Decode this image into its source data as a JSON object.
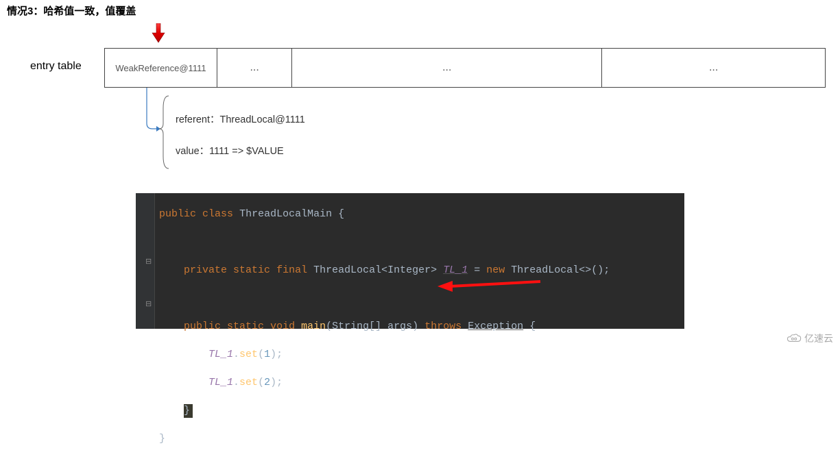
{
  "title": "情况3：哈希值一致，值覆盖",
  "table_label": "entry table",
  "cells": {
    "c0": "WeakReference@1111",
    "c1": "...",
    "c2": "...",
    "c3": "..."
  },
  "detail": {
    "referent": "referent：ThreadLocal@1111",
    "value": "value：1111  => $VALUE"
  },
  "code": {
    "l1_public": "public",
    "l1_class": "class",
    "l1_name": "ThreadLocalMain",
    "l1_brace": " {",
    "l3_private": "private",
    "l3_static": "static",
    "l3_final": "final",
    "l3_type": "ThreadLocal",
    "l3_generic_open": "<",
    "l3_gtype": "Integer",
    "l3_generic_close": ">",
    "l3_field": "TL_1",
    "l3_eq": " = ",
    "l3_new": "new",
    "l3_ctor": " ThreadLocal",
    "l3_diamond": "<>();",
    "l5_public": "public",
    "l5_static": "static",
    "l5_void": "void",
    "l5_main": "main",
    "l5_p_open": "(",
    "l5_ptype": "String",
    "l5_arr": "[] ",
    "l5_pname": "args",
    "l5_p_close": ") ",
    "l5_throws": "throws",
    "l5_exc": "Exception",
    "l5_brace": " {",
    "l6_field": "TL_1",
    "l6_dot": ".",
    "l6_method": "set",
    "l6_open": "(",
    "l6_arg": "1",
    "l6_close": ");",
    "l7_field": "TL_1",
    "l7_dot": ".",
    "l7_method": "set",
    "l7_open": "(",
    "l7_arg": "2",
    "l7_close": ");",
    "l8_brace": "}",
    "l9_brace": "}"
  },
  "watermark": "亿速云"
}
